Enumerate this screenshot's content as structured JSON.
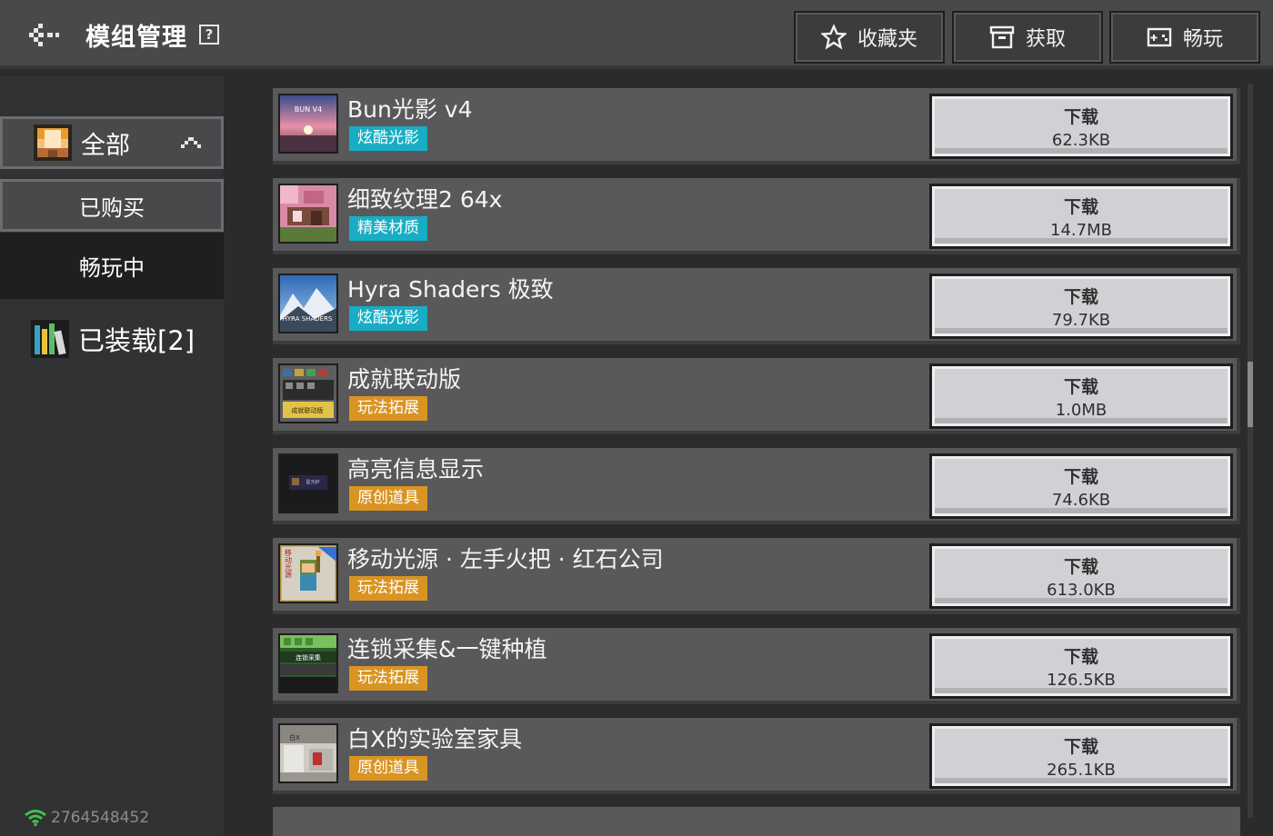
{
  "header": {
    "title": "模组管理",
    "help": "?",
    "buttons": [
      {
        "label": "收藏夹",
        "icon": "star-icon"
      },
      {
        "label": "获取",
        "icon": "archive-box-icon"
      },
      {
        "label": "畅玩",
        "icon": "gamepad-icon"
      }
    ]
  },
  "sidebar": {
    "all_label": "全部",
    "purchased_label": "已购买",
    "playing_label": "畅玩中",
    "installed_label": "已装载[2]",
    "user_id": "2764548452"
  },
  "items": [
    {
      "name": "Bun光影 v4",
      "tag": "炫酷光影",
      "tag_color": "#17aec5",
      "button": "下载",
      "size": "62.3KB",
      "thumb_text": "BUN V4"
    },
    {
      "name": "细致纹理2 64x",
      "tag": "精美材质",
      "tag_color": "#17aec5",
      "button": "下载",
      "size": "14.7MB",
      "thumb_text": ""
    },
    {
      "name": "Hyra Shaders 极致",
      "tag": "炫酷光影",
      "tag_color": "#17aec5",
      "button": "下载",
      "size": "79.7KB",
      "thumb_text": "HYRA SHADERS"
    },
    {
      "name": "成就联动版",
      "tag": "玩法拓展",
      "tag_color": "#d99421",
      "button": "下载",
      "size": "1.0MB",
      "thumb_text": "成就联动版"
    },
    {
      "name": "高亮信息显示",
      "tag": "原创道具",
      "tag_color": "#d99421",
      "button": "下载",
      "size": "74.6KB",
      "thumb_text": "星元炉"
    },
    {
      "name": "移动光源 · 左手火把 · 红石公司",
      "tag": "玩法拓展",
      "tag_color": "#d99421",
      "button": "下载",
      "size": "613.0KB",
      "thumb_text": "移动光源"
    },
    {
      "name": "连锁采集&一键种植",
      "tag": "玩法拓展",
      "tag_color": "#d99421",
      "button": "下载",
      "size": "126.5KB",
      "thumb_text": "连锁采集"
    },
    {
      "name": "白X的实验室家具",
      "tag": "原创道具",
      "tag_color": "#d99421",
      "button": "下载",
      "size": "265.1KB",
      "thumb_text": "白X"
    }
  ],
  "colors": {
    "topbar": "#48494a",
    "tag_cyan": "#17aec5",
    "tag_orange": "#d99421",
    "button_face": "#d0d1d4"
  }
}
